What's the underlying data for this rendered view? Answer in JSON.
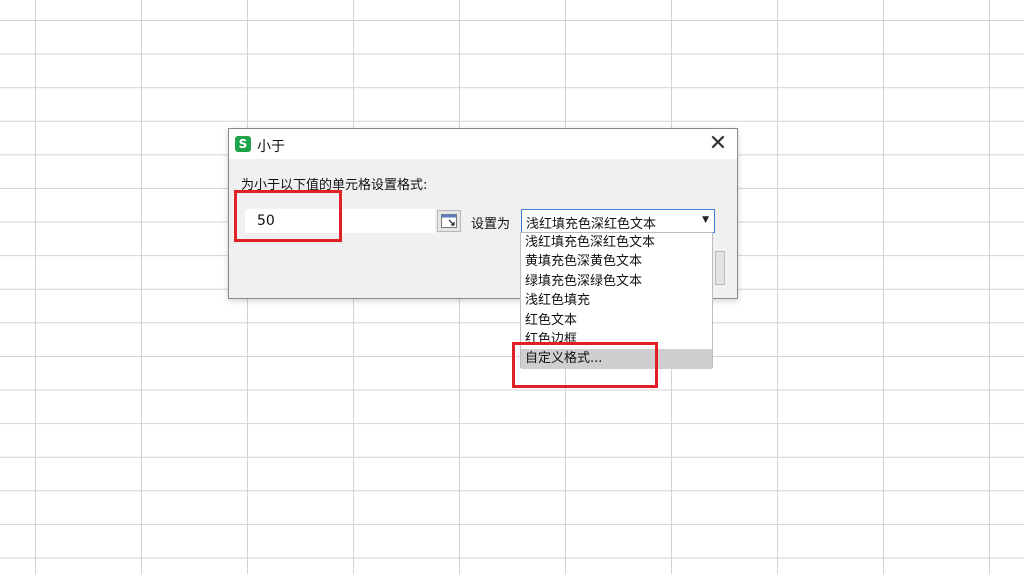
{
  "dialog": {
    "title": "小于",
    "app_icon_glyph": "S",
    "prompt": "为小于以下值的单元格设置格式:",
    "value": "50",
    "set_label": "设置为",
    "selected_format": "浅红填充色深红色文本",
    "close_glyph": "✕"
  },
  "dropdown": {
    "options": [
      "浅红填充色深红色文本",
      "黄填充色深黄色文本",
      "绿填充色深绿色文本",
      "浅红色填充",
      "红色文本",
      "红色边框",
      "自定义格式..."
    ],
    "highlighted_option": "自定义格式..."
  },
  "colors": {
    "annotation_red": "#e01f26",
    "app_icon_green": "#1fa34a",
    "select_border_blue": "#3c7fd6"
  }
}
